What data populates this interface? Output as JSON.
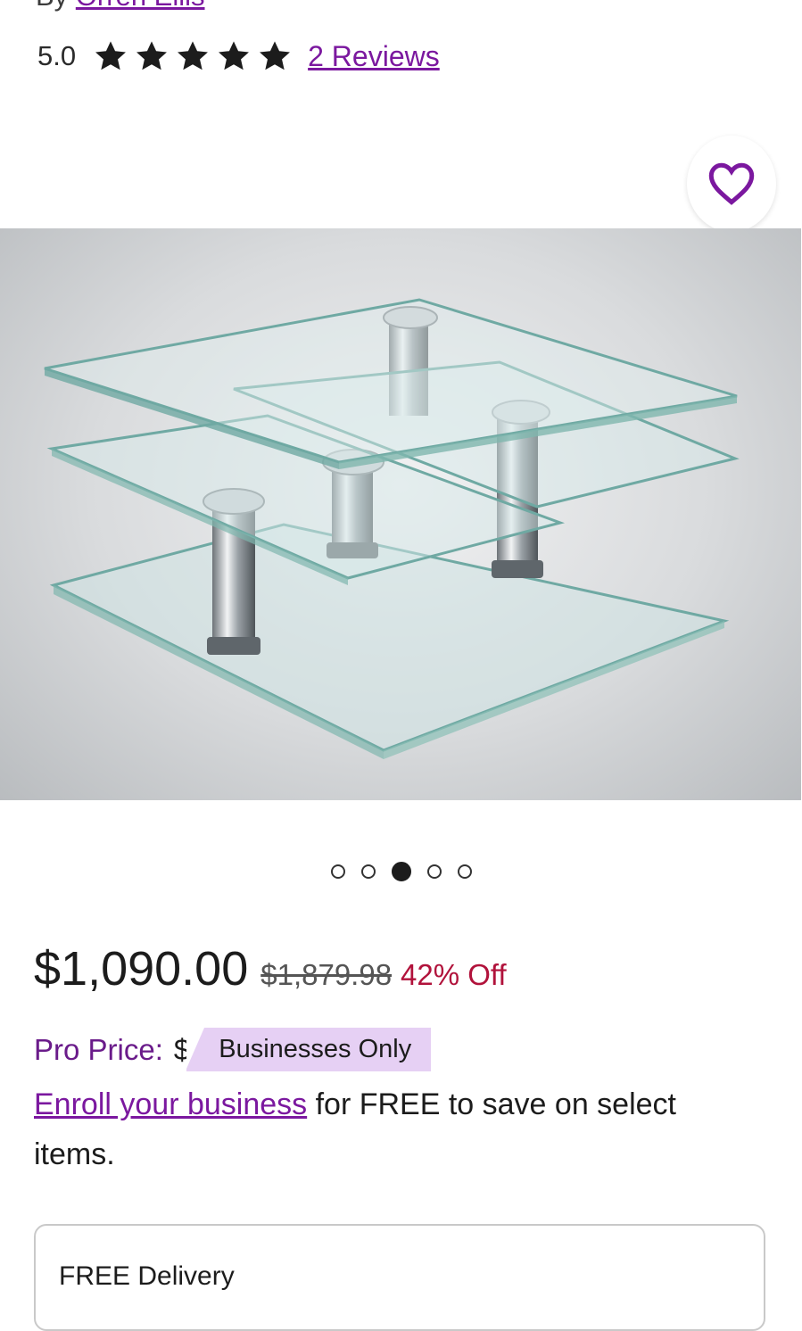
{
  "byline": {
    "prefix": "By",
    "brand": "Orren Ellis"
  },
  "rating": {
    "value": "5.0",
    "stars": 5,
    "reviews_label": "2 Reviews"
  },
  "favorite": {
    "icon": "heart-icon",
    "color": "#7b189f"
  },
  "gallery": {
    "image": "glass-swivel-coffee-table",
    "total": 5,
    "active_index": 2
  },
  "pricing": {
    "price": "$1,090.00",
    "original_price": "$1,879.98",
    "discount": "42% Off"
  },
  "pro": {
    "label": "Pro Price:",
    "symbol": "$",
    "badge": "Businesses Only"
  },
  "enroll": {
    "link": "Enroll your business",
    "text": " for FREE to save on select items."
  },
  "delivery": {
    "label": "FREE Delivery"
  },
  "colors": {
    "accent": "#7b189f",
    "discount": "#b1123b",
    "badge_bg": "#e6d0f4"
  }
}
